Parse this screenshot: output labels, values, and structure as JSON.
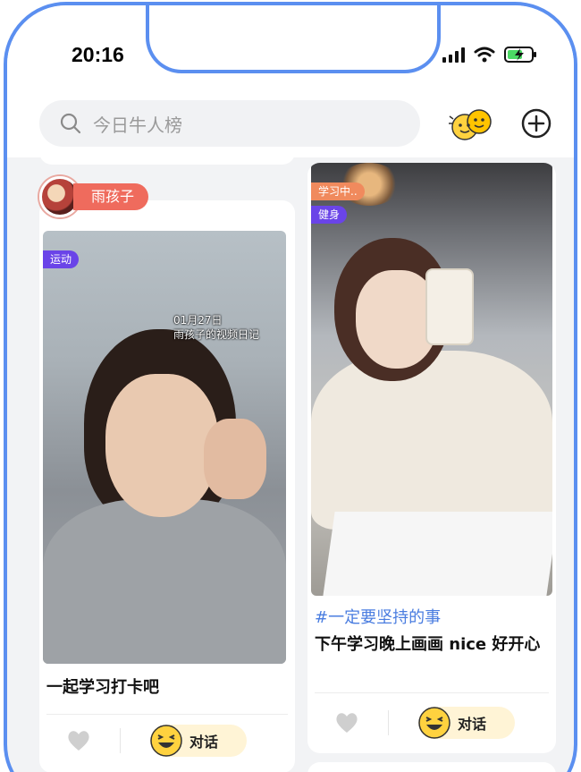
{
  "status_bar": {
    "time": "20:16"
  },
  "search": {
    "placeholder": "今日牛人榜"
  },
  "colors": {
    "accent_blue": "#5b8ff0",
    "name_badge": "#ef6b5d",
    "tag_purple": "#6a44e8",
    "tag_orange": "#f08a5d",
    "topic_blue": "#4a7de0",
    "chat_button_bg": "#fff4d6"
  },
  "icons": {
    "search": "search-icon",
    "friends": "friends-emoji-icon",
    "add": "add-circle-icon",
    "like": "heart-icon",
    "chat": "laughing-emoji-icon"
  },
  "feed": {
    "left_card": {
      "user_name": "雨孩子",
      "tag": "运动",
      "overlay_date": "01月27日",
      "overlay_title": "雨孩子的视频日记",
      "caption": "一起学习打卡吧",
      "chat_label": "对话"
    },
    "right_card": {
      "status_tag": "学习中..",
      "tag": "健身",
      "topic": "#一定要坚持的事",
      "caption": "下午学习晚上画画 nice 好开心",
      "chat_label": "对话"
    }
  }
}
